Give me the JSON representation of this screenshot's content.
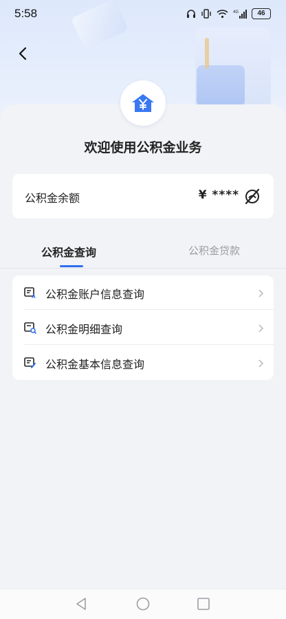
{
  "status": {
    "time": "5:58",
    "battery": "46",
    "network": "4G"
  },
  "header": {
    "back_icon": "chevron-left-icon"
  },
  "logo": {
    "icon": "house-yen-icon",
    "color": "#3a78f2"
  },
  "welcome": "欢迎使用公积金业务",
  "balance": {
    "label": "公积金余额",
    "value": "¥ ****",
    "toggle_icon": "eye-hidden-icon"
  },
  "tabs": [
    {
      "label": "公积金查询",
      "active": true
    },
    {
      "label": "公积金贷款",
      "active": false
    }
  ],
  "menu": {
    "items": [
      {
        "label": "公积金账户信息查询",
        "icon": "account-doc-icon"
      },
      {
        "label": "公积金明细查询",
        "icon": "detail-search-icon"
      },
      {
        "label": "公积金基本信息查询",
        "icon": "info-edit-icon"
      }
    ]
  },
  "navbar": {
    "back": "triangle-back-icon",
    "home": "circle-home-icon",
    "recents": "square-recents-icon"
  },
  "colors": {
    "accent": "#2f6ff0",
    "background": "#f2f3f7"
  }
}
